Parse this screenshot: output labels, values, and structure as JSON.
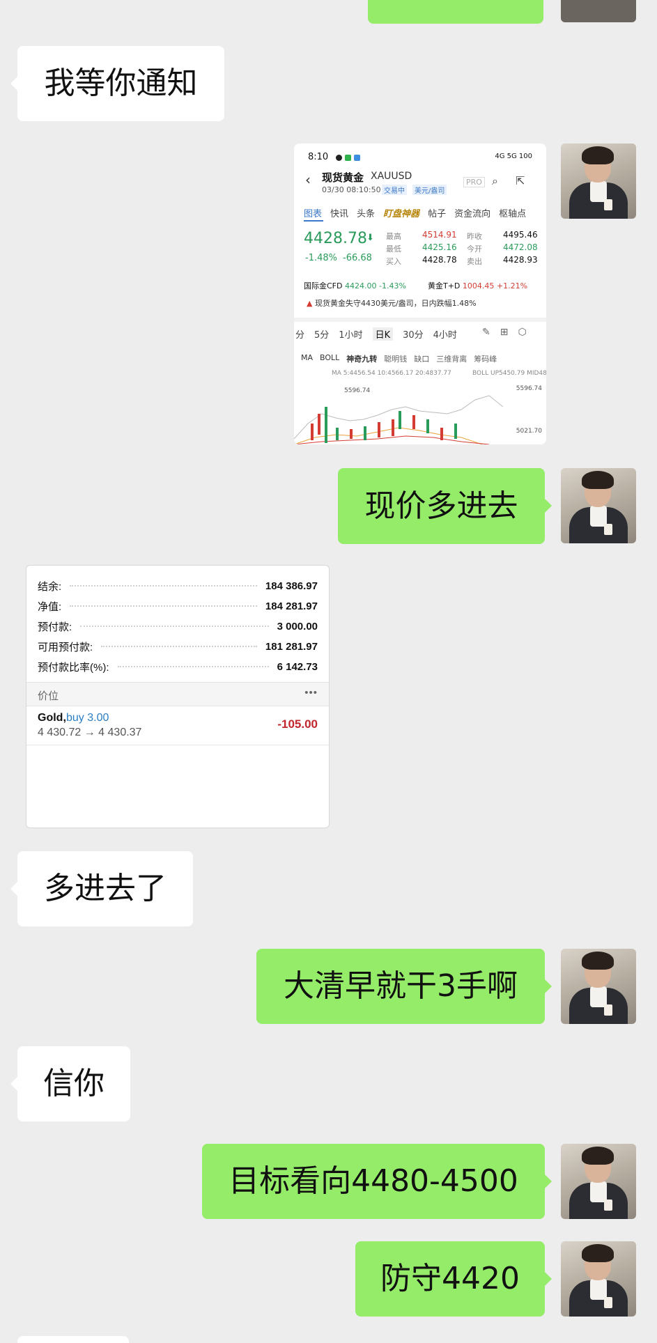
{
  "messages": {
    "m1": "我等你通知",
    "m2": "现价多进去",
    "m3": "多进去了",
    "m4": "大清早就干3手啊",
    "m5": "信你",
    "m6": "目标看向4480-4500",
    "m7": "防守4420"
  },
  "stock_screenshot": {
    "status_time": "8:10",
    "status_right": "4G 5G 100",
    "title": "现货黄金",
    "symbol": "XAUUSD",
    "datetime": "03/30 08:10:50",
    "trading_tag": "交易中",
    "unit_tag": "美元/盎司",
    "pro": "PRO",
    "tabs": [
      "图表",
      "快讯",
      "头条",
      "盯盘神器",
      "帖子",
      "资金流向",
      "枢轴点"
    ],
    "price": "4428.78",
    "change_pct": "-1.48%",
    "change_abs": "-66.68",
    "stats": {
      "high_label": "最高",
      "high": "4514.91",
      "low_label": "最低",
      "low": "4425.16",
      "buy_label": "买入",
      "buy": "4428.78",
      "prev_label": "昨收",
      "prev": "4495.46",
      "open_label": "今开",
      "open": "4472.08",
      "sell_label": "卖出",
      "sell": "4428.93"
    },
    "cfd_label": "国际金CFD",
    "cfd_value": "4424.00",
    "cfd_change": "-1.43%",
    "td_label": "黄金T+D",
    "td_value": "1004.45",
    "td_change": "+1.21%",
    "news": "现货黄金失守4430美元/盎司，日内跌幅1.48%",
    "periods": [
      "分",
      "5分",
      "1小时",
      "日K",
      "30分",
      "4小时"
    ],
    "indicators": [
      "MA",
      "BOLL",
      "神奇九转",
      "聪明钱",
      "缺口",
      "三维背离",
      "筹码峰"
    ],
    "ma_label": "MA 5:4456.54 10:4566.17 20:4837.77",
    "boll_label": "BOLL UP5450.79 MID48",
    "chart_high": "5596.74",
    "chart_axis_top": "5596.74",
    "chart_axis_bottom": "5021.70"
  },
  "account": {
    "rows": [
      {
        "label": "结余:",
        "value": "184 386.97"
      },
      {
        "label": "净值:",
        "value": "184 281.97"
      },
      {
        "label": "预付款:",
        "value": "3 000.00"
      },
      {
        "label": "可用预付款:",
        "value": "181 281.97"
      },
      {
        "label": "预付款比率(%):",
        "value": "6 142.73"
      }
    ],
    "positions_header": "价位",
    "more": "•••",
    "position_symbol": "Gold,",
    "position_side": "buy 3.00",
    "position_prices": "4 430.72 → 4 430.37",
    "position_pnl": "-105.00"
  },
  "colors": {
    "background": "#ededed",
    "bubble_self": "#95ec69",
    "bubble_other": "#ffffff",
    "loss_red": "#c0262c",
    "buy_blue": "#2a7ec6"
  }
}
